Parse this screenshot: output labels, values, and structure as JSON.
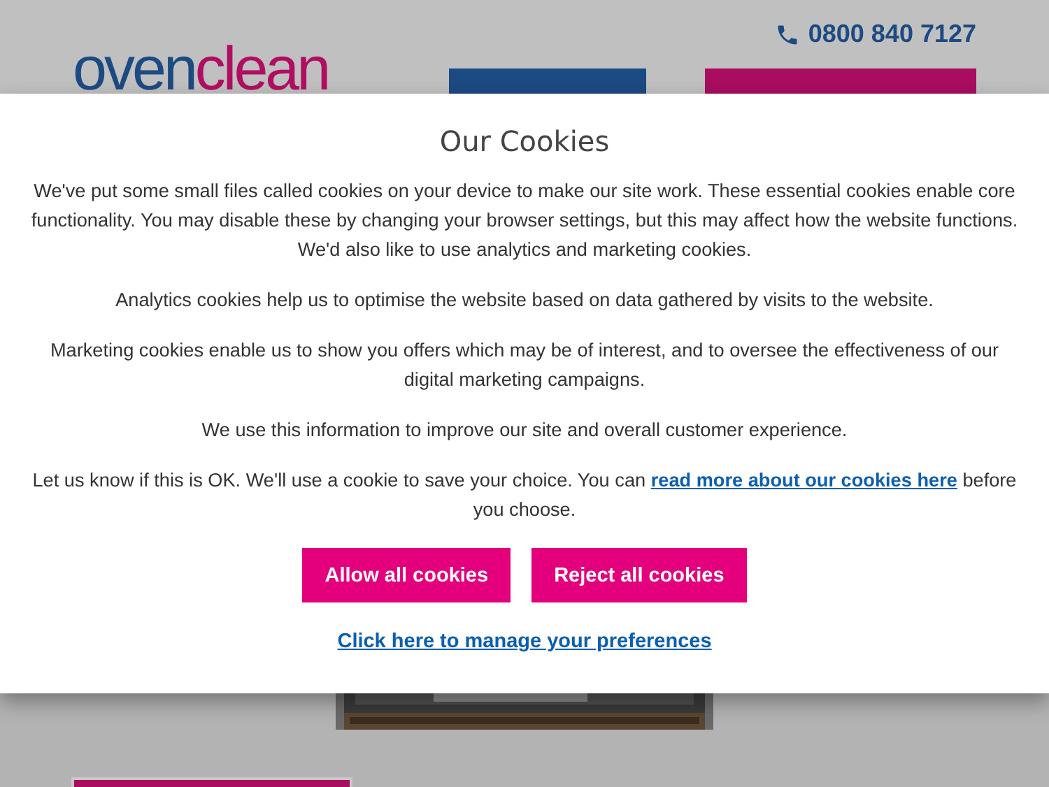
{
  "header": {
    "logo": {
      "first": "oven",
      "second": "clean"
    },
    "phone": "0800 840 7127",
    "buttons": [
      {
        "kind": "menu"
      },
      {
        "kind": "quote"
      }
    ]
  },
  "cookie_dialog": {
    "title": "Our Cookies",
    "paragraphs": [
      {
        "text": "We've put some small files called cookies on your device to make our site work. These essential cookies enable core functionality. You may disable these by changing your browser settings, but this may affect how the website functions. We'd also like to use analytics and marketing cookies."
      },
      {
        "text": "Analytics cookies help us to optimise the website based on data gathered by visits to the website."
      },
      {
        "text": "Marketing cookies enable us to show you offers which may be of interest, and to oversee the effectiveness of our digital marketing campaigns."
      },
      {
        "text": "We use this information to improve our site and overall customer experience."
      },
      {
        "text": "Let us know if this is OK. We'll use a cookie to save your choice. You can ",
        "link": "read more about our cookies here",
        "after": " before you choose."
      }
    ],
    "buttons": [
      "Allow all cookies",
      "Reject all cookies"
    ],
    "preferences_link": "Click here to manage your preferences"
  }
}
